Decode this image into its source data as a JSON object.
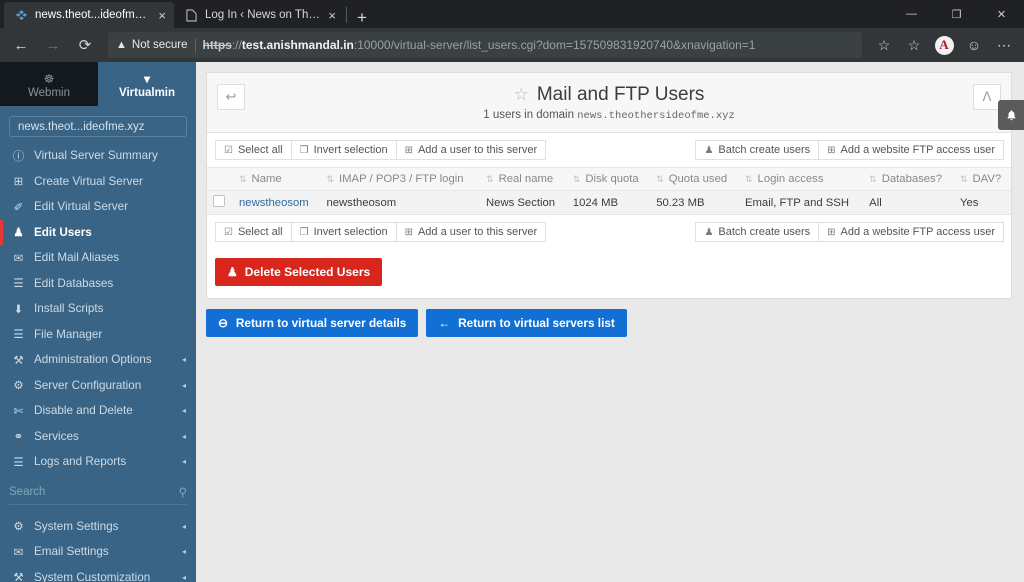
{
  "browser": {
    "tabs": [
      {
        "title": "news.theot...ideofme.xyz - Mail a",
        "favicon": "virtualmin-icon",
        "close": "×",
        "active": true
      },
      {
        "title": "Log In ‹ News on The Othet Side",
        "favicon": "page-icon",
        "close": "×",
        "active": false
      }
    ],
    "new_tab_label": "+",
    "window_controls": {
      "minimize": "—",
      "maximize": "❐",
      "close": "✕"
    },
    "nav": {
      "back": "←",
      "forward": "→",
      "reload": "⟳"
    },
    "security": {
      "icon": "warning-triangle-icon",
      "label": "Not secure"
    },
    "url": {
      "scheme": "https",
      "separator": "://",
      "host": "test.anishmandal.in",
      "rest": ":10000/virtual-server/list_users.cgi?dom=157509831920740&xnavigation=1"
    },
    "toolbar": {
      "favorite": "☆",
      "collections": "☆",
      "profile_letter": "A",
      "feedback": "☺",
      "more": "⋯"
    }
  },
  "sidebar": {
    "tabs": [
      {
        "label": "Webmin",
        "icon": "webmin-logo-icon"
      },
      {
        "label": "Virtualmin",
        "icon": "chevron-down-icon"
      }
    ],
    "domain_selector": "news.theot...ideofme.xyz",
    "items": [
      {
        "label": "Virtual Server Summary",
        "icon": "ⓘ",
        "caret": "",
        "active": false
      },
      {
        "label": "Create Virtual Server",
        "icon": "⊞",
        "caret": "",
        "active": false
      },
      {
        "label": "Edit Virtual Server",
        "icon": "✐",
        "caret": "",
        "active": false
      },
      {
        "label": "Edit Users",
        "icon": "♟",
        "caret": "",
        "active": true
      },
      {
        "label": "Edit Mail Aliases",
        "icon": "✉",
        "caret": "",
        "active": false
      },
      {
        "label": "Edit Databases",
        "icon": "☰",
        "caret": "",
        "active": false
      },
      {
        "label": "Install Scripts",
        "icon": "⬇",
        "caret": "",
        "active": false
      },
      {
        "label": "File Manager",
        "icon": "☰",
        "caret": "",
        "active": false
      },
      {
        "label": "Administration Options",
        "icon": "⚒",
        "caret": "◂",
        "active": false
      },
      {
        "label": "Server Configuration",
        "icon": "⚙",
        "caret": "◂",
        "active": false
      },
      {
        "label": "Disable and Delete",
        "icon": "✄",
        "caret": "◂",
        "active": false
      },
      {
        "label": "Services",
        "icon": "⚭",
        "caret": "◂",
        "active": false
      },
      {
        "label": "Logs and Reports",
        "icon": "☰",
        "caret": "◂",
        "active": false
      }
    ],
    "search_placeholder": "Search",
    "search_icon": "search-icon",
    "bottom_items": [
      {
        "label": "System Settings",
        "icon": "⚙",
        "caret": "◂"
      },
      {
        "label": "Email Settings",
        "icon": "✉",
        "caret": "◂"
      },
      {
        "label": "System Customization",
        "icon": "⚒",
        "caret": "◂"
      }
    ]
  },
  "main": {
    "back_button_icon": "↩",
    "filter_button_icon": "ᐱ",
    "title": "Mail and FTP Users",
    "star_icon": "☆",
    "subtitle_prefix": "1 users in domain",
    "subtitle_domain": "news.theothersideofme.xyz",
    "top_left_buttons": [
      {
        "label": "Select all",
        "icon": "☑"
      },
      {
        "label": "Invert selection",
        "icon": "❐"
      },
      {
        "label": "Add a user to this server",
        "icon": "⊞"
      }
    ],
    "top_right_buttons": [
      {
        "label": "Batch create users",
        "icon": "♟"
      },
      {
        "label": "Add a website FTP access user",
        "icon": "⊞"
      }
    ],
    "table": {
      "columns": [
        "Name",
        "IMAP / POP3 / FTP login",
        "Real name",
        "Disk quota",
        "Quota used",
        "Login access",
        "Databases?",
        "DAV?"
      ],
      "sort_icon": "⇅",
      "rows": [
        {
          "checked": false,
          "name": "newstheosom",
          "login": "newstheosom",
          "real_name": "News Section",
          "disk_quota": "1024 MB",
          "quota_used": "50.23 MB",
          "login_access": "Email, FTP and SSH",
          "databases": "All",
          "dav": "Yes"
        }
      ]
    },
    "bottom_left_buttons": [
      {
        "label": "Select all",
        "icon": "☑"
      },
      {
        "label": "Invert selection",
        "icon": "❐"
      },
      {
        "label": "Add a user to this server",
        "icon": "⊞"
      }
    ],
    "bottom_right_buttons": [
      {
        "label": "Batch create users",
        "icon": "♟"
      },
      {
        "label": "Add a website FTP access user",
        "icon": "⊞"
      }
    ],
    "delete_button": {
      "label": "Delete Selected Users",
      "icon": "♟",
      "color": "#d9261c"
    },
    "footer_buttons": [
      {
        "label": "Return to virtual server details",
        "icon": "⊖",
        "color": "#1270d4"
      },
      {
        "label": "Return to virtual servers list",
        "icon": "←",
        "color": "#1270d4"
      }
    ],
    "notification_bell_icon": "🔔"
  }
}
